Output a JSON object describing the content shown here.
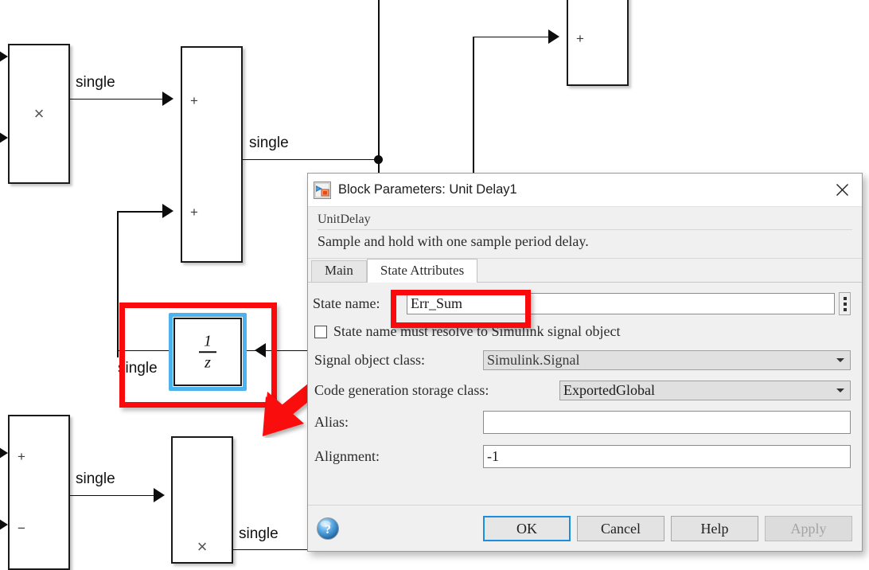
{
  "diagram": {
    "signal_labels": [
      {
        "text": "single"
      },
      {
        "text": "single"
      },
      {
        "text": "single"
      },
      {
        "text": "single"
      },
      {
        "text": "single"
      },
      {
        "text": "single"
      }
    ],
    "blocks": {
      "product_top": {
        "operator": "×"
      },
      "sum_top_mid": {
        "port1": "+",
        "port2": "+"
      },
      "sum_top_right": {
        "port1": "+"
      },
      "unit_delay": {
        "numerator": "1",
        "denominator": "z"
      },
      "sum_bottom": {
        "port1": "+",
        "port2": "−"
      },
      "product_bottom": {
        "operator": "×"
      }
    },
    "annotation": {
      "color": "#fa0a0a",
      "selection_color": "#4db3ef"
    }
  },
  "dialog": {
    "title": "Block Parameters: Unit Delay1",
    "icon": "simulink-block-icon",
    "close_label": "✕",
    "description": {
      "type": "UnitDelay",
      "text": "Sample and hold with one sample period delay."
    },
    "tabs": [
      {
        "label": "Main",
        "active": false
      },
      {
        "label": "State Attributes",
        "active": true
      }
    ],
    "fields": {
      "state_name": {
        "label": "State name:",
        "value": "Err_Sum",
        "placeholder": ""
      },
      "resolve_checkbox": {
        "label": "State name must resolve to Simulink signal object",
        "checked": false
      },
      "signal_object_class": {
        "label": "Signal object class:",
        "value": "Simulink.Signal",
        "enabled": false
      },
      "storage_class": {
        "label": "Code generation storage class:",
        "value": "ExportedGlobal",
        "enabled": true
      },
      "alias": {
        "label": "Alias:",
        "value": "",
        "placeholder": ""
      },
      "alignment": {
        "label": "Alignment:",
        "value": "-1",
        "placeholder": ""
      }
    },
    "buttons": {
      "ok": "OK",
      "cancel": "Cancel",
      "help": "Help",
      "apply": "Apply"
    },
    "accent_color": "#1a8fe0"
  }
}
